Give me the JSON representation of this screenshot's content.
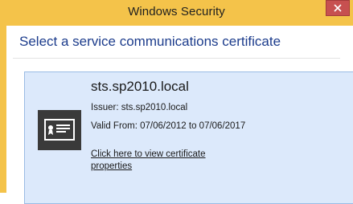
{
  "window": {
    "title": "Windows Security",
    "close_icon": "close-icon",
    "accent_color": "#f4c34a",
    "close_color": "#c75050"
  },
  "dialog": {
    "heading": "Select a service communications certificate"
  },
  "certificate": {
    "icon": "certificate-icon",
    "name": "sts.sp2010.local",
    "issuer": "Issuer: sts.sp2010.local",
    "valid": "Valid From: 07/06/2012 to 07/06/2017",
    "link": "Click here to view certificate properties",
    "tile_color": "#dce9fb"
  }
}
